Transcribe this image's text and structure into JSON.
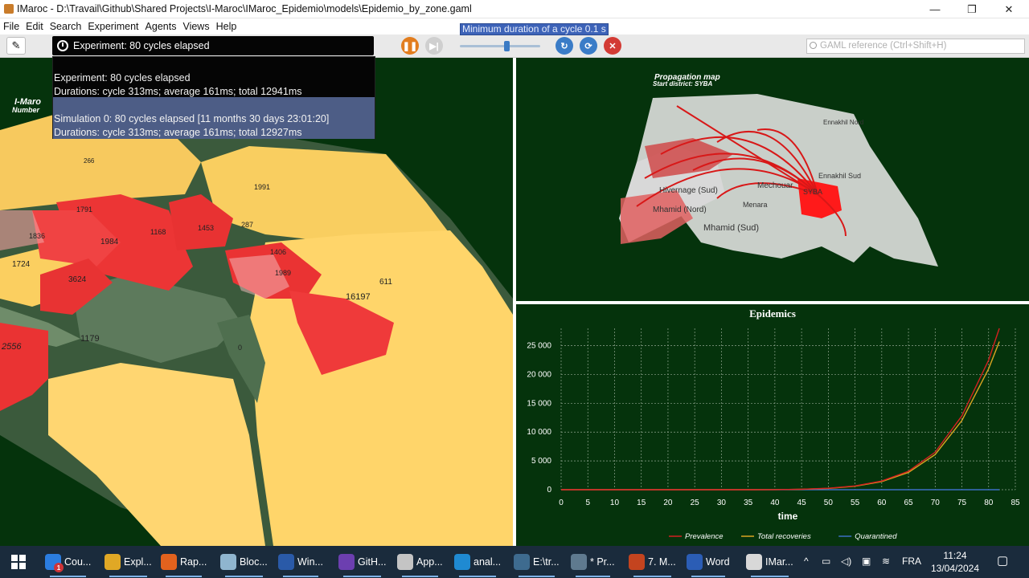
{
  "window": {
    "title": "IMaroc - D:\\Travail\\Github\\Shared Projects\\I-Maroc\\IMaroc_Epidemio\\models\\Epidemio_by_zone.gaml",
    "minimize": "—",
    "restore": "❐",
    "close": "✕"
  },
  "menu": [
    "File",
    "Edit",
    "Search",
    "Experiment",
    "Agents",
    "Views",
    "Help"
  ],
  "toolbar": {
    "experiment_status": "Experiment: 80 cycles elapsed",
    "tooltip": "Minimum duration of a cycle 0.1 s",
    "search_placeholder": "GAML reference (Ctrl+Shift+H)",
    "speed_slider_value": 0.58
  },
  "popup": {
    "experiment_line1": "Experiment: 80 cycles elapsed",
    "experiment_line2": "Durations: cycle 313ms; average 161ms; total 12941ms",
    "simulation_line1": "Simulation 0: 80 cycles elapsed [11 months 30 days 23:01:20]",
    "simulation_line2": "Durations: cycle 313ms; average 161ms; total 12927ms"
  },
  "left_map": {
    "title": "I-Maro",
    "subtitle": "Number",
    "zone_labels": [
      "266",
      "1991",
      "1791",
      "1168",
      "1453",
      "287",
      "1984",
      "1836",
      "1406",
      "1724",
      "1989",
      "3624",
      "611",
      "16197",
      "1179",
      "2556",
      "0"
    ]
  },
  "right_map": {
    "title": "Propagation map",
    "subtitle": "Start district: SYBA",
    "district_labels": [
      "Ennakhil Nord",
      "Ennakhil Sud",
      "Mechouar",
      "SYBA",
      "Hivernage (Sud)",
      "Mhamid (Nord)",
      "Mhamid (Sud)",
      "Menara"
    ]
  },
  "chart_data": {
    "type": "line",
    "title": "Epidemics",
    "xlabel": "time",
    "ylabel": "",
    "xlim": [
      0,
      85
    ],
    "ylim": [
      0,
      28000
    ],
    "x_ticks": [
      "0",
      "5",
      "10",
      "15",
      "20",
      "25",
      "30",
      "35",
      "40",
      "45",
      "50",
      "55",
      "60",
      "65",
      "70",
      "75",
      "80",
      "85"
    ],
    "y_ticks": [
      "0",
      "5 000",
      "10 000",
      "15 000",
      "20 000",
      "25 000"
    ],
    "grid": true,
    "legend_position": "bottom",
    "x": [
      0,
      5,
      10,
      15,
      20,
      25,
      30,
      35,
      40,
      45,
      50,
      55,
      60,
      65,
      70,
      75,
      80,
      82
    ],
    "series": [
      {
        "name": "Prevalence",
        "color": "#d42020",
        "values": [
          0,
          0,
          0,
          0,
          0,
          0,
          0,
          0,
          20,
          80,
          250,
          650,
          1500,
          3200,
          6500,
          12800,
          22500,
          28000
        ]
      },
      {
        "name": "Total recoveries",
        "color": "#d9a521",
        "values": [
          0,
          0,
          0,
          0,
          0,
          0,
          0,
          0,
          15,
          65,
          220,
          600,
          1400,
          3000,
          6100,
          12000,
          21000,
          25700
        ]
      },
      {
        "name": "Quarantined",
        "color": "#3d6fc4",
        "values": [
          0,
          0,
          0,
          0,
          0,
          0,
          0,
          0,
          0,
          0,
          0,
          0,
          0,
          0,
          0,
          0,
          0,
          0
        ]
      }
    ]
  },
  "taskbar": {
    "items": [
      {
        "label": "Cou...",
        "color": "#2b7de0",
        "icon": "edge-icon"
      },
      {
        "label": "Expl...",
        "color": "#e0a825",
        "icon": "folder-icon"
      },
      {
        "label": "Rap...",
        "color": "#e2621e",
        "icon": "firefox-icon"
      },
      {
        "label": "Bloc...",
        "color": "#8fb5cf",
        "icon": "notepad-icon"
      },
      {
        "label": "Win...",
        "color": "#2a5aa8",
        "icon": "powershell-icon"
      },
      {
        "label": "GitH...",
        "color": "#6c3fb0",
        "icon": "github-icon"
      },
      {
        "label": "App...",
        "color": "#c4c4c4",
        "icon": "pdf-icon"
      },
      {
        "label": "anal...",
        "color": "#1f8ad2",
        "icon": "vscode-icon"
      },
      {
        "label": "E:\\tr...",
        "color": "#3e6b8f",
        "icon": "globe-icon"
      },
      {
        "label": "* Pr...",
        "color": "#5f7a8f",
        "icon": "globe-icon"
      },
      {
        "label": "7. M...",
        "color": "#c4441f",
        "icon": "powerpoint-icon"
      },
      {
        "label": "Word",
        "color": "#2b5db5",
        "icon": "word-icon"
      },
      {
        "label": "IMar...",
        "color": "#d8d8d8",
        "icon": "gama-icon"
      }
    ],
    "notification_badge": "1",
    "language": "FRA",
    "time": "11:24",
    "date": "13/04/2024"
  }
}
